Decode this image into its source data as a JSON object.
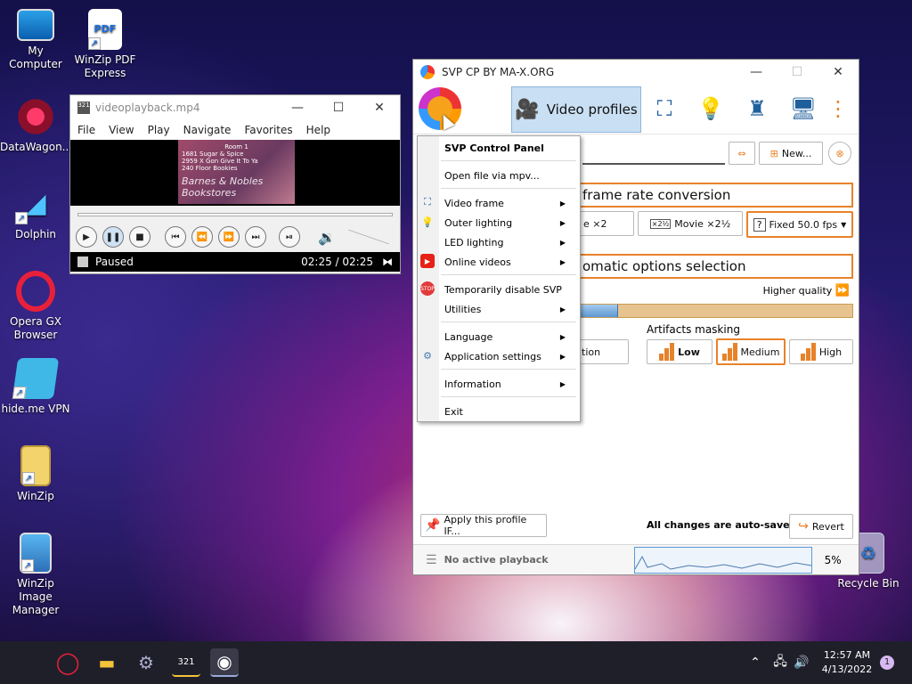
{
  "desktop": {
    "icons": [
      {
        "label": "My Computer"
      },
      {
        "label": "WinZip PDF Express"
      },
      {
        "label": "DataWagon..."
      },
      {
        "label": "Dolphin"
      },
      {
        "label": "Opera GX Browser"
      },
      {
        "label": "hide.me VPN"
      },
      {
        "label": "WinZip"
      },
      {
        "label": "WinZip Image Manager"
      },
      {
        "label": "Recycle Bin"
      }
    ]
  },
  "player": {
    "title": "videoplayback.mp4",
    "menu": [
      "File",
      "View",
      "Play",
      "Navigate",
      "Favorites",
      "Help"
    ],
    "poster_lines": [
      "Room 1",
      "1681 Sugar & Spice",
      "2959 X Gon Give It To Ya",
      "240 Floor Bookies",
      "Barnes & Nobles Bookstores"
    ],
    "status": "Paused",
    "time": "02:25 / 02:25"
  },
  "svp": {
    "title": "SVP CP BY MA-X.ORG",
    "active_tab": "Video profiles",
    "new_button": "New...",
    "frc_label": "frame rate conversion",
    "frc_options": [
      {
        "label": "e ×2"
      },
      {
        "label": "Movie ×2½"
      },
      {
        "label": "Fixed 50.0 fps"
      }
    ],
    "auto_label": "omatic options selection",
    "higher_quality": "Higher quality",
    "artifacts_title": "Artifacts masking",
    "artifacts_options": [
      "Low",
      "Medium",
      "High"
    ],
    "left_partial_button": "tion",
    "apply_profile": "Apply this profile IF...",
    "auto_saved": "All changes are auto-saved",
    "revert": "Revert",
    "playback_status": "No active playback",
    "cpu_percent": "5%",
    "quality_level": 0.14
  },
  "context_menu": {
    "header": "SVP Control Panel",
    "items": [
      {
        "label": "Open file via mpv..."
      },
      {
        "label": "Video frame"
      },
      {
        "label": "Outer lighting"
      },
      {
        "label": "LED lighting"
      },
      {
        "label": "Online videos"
      },
      {
        "label": "Temporarily disable SVP"
      },
      {
        "label": "Utilities"
      },
      {
        "label": "Language"
      },
      {
        "label": "Application settings"
      },
      {
        "label": "Information"
      },
      {
        "label": "Exit"
      }
    ]
  },
  "taskbar": {
    "time": "12:57 AM",
    "date": "4/13/2022",
    "notification_count": "1"
  },
  "colors": {
    "accent": "#e8822a",
    "tab_active": "#c9dff3",
    "taskbar": "#1f1f2a"
  }
}
